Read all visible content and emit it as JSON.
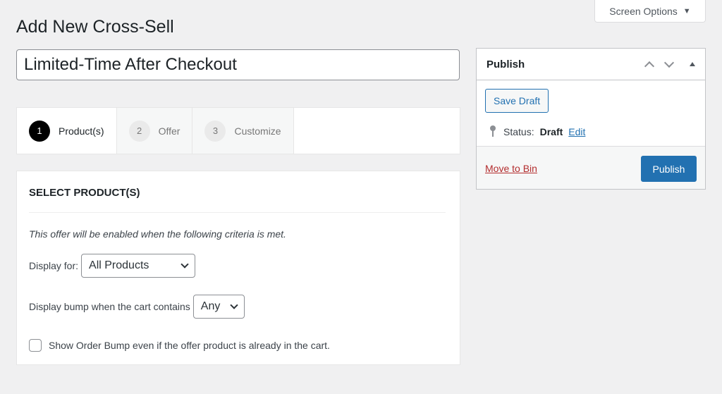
{
  "screen_options": {
    "label": "Screen Options"
  },
  "page_title": "Add New Cross-Sell",
  "title_input": {
    "value": "Limited-Time After Checkout"
  },
  "steps": [
    {
      "number": "1",
      "label": "Product(s)",
      "active": true
    },
    {
      "number": "2",
      "label": "Offer",
      "active": false
    },
    {
      "number": "3",
      "label": "Customize",
      "active": false
    }
  ],
  "panel": {
    "title": "SELECT PRODUCT(S)",
    "description": "This offer will be enabled when the following criteria is met.",
    "display_for": {
      "label": "Display for:",
      "selected": "All Products"
    },
    "bump_contains": {
      "label": "Display bump when the cart contains",
      "selected": "Any"
    },
    "checkbox": {
      "label": "Show Order Bump even if the offer product is already in the cart.",
      "checked": false
    }
  },
  "publish": {
    "title": "Publish",
    "save_draft": "Save Draft",
    "status_label": "Status:",
    "status_value": "Draft",
    "edit_link": "Edit",
    "move_to_bin": "Move to Bin",
    "publish_button": "Publish"
  },
  "colors": {
    "accent": "#2271b1",
    "danger": "#b32d2e",
    "background": "#f0f0f1"
  }
}
